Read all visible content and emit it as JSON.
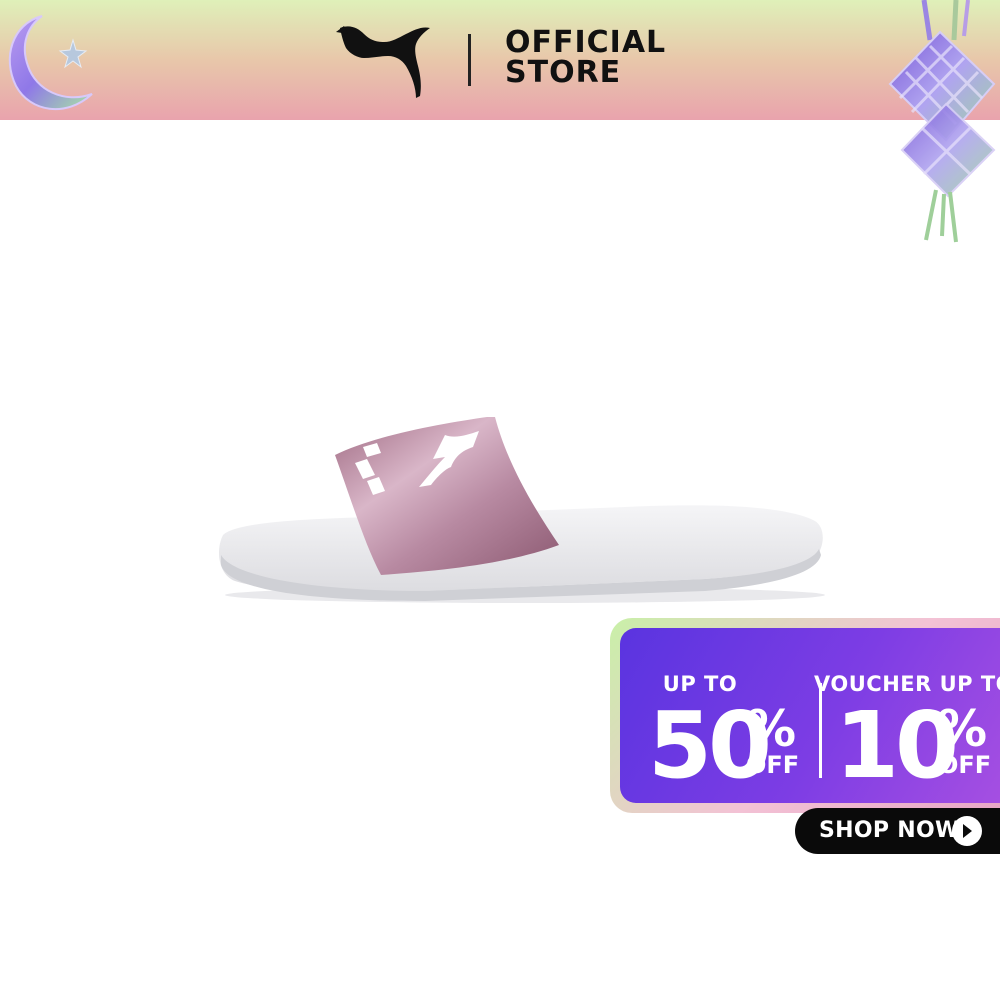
{
  "header": {
    "brand_logo_name": "puma-logo",
    "store_line1": "OFFICIAL",
    "store_line2": "STORE",
    "colors": {
      "top": "#dff0b9",
      "bottom": "#e9a3ad"
    },
    "decorations": [
      "crescent-moon-star-icon",
      "ketupat-icon"
    ]
  },
  "product": {
    "image_name": "puma-slide-sandal-image",
    "colors": {
      "sole": "#f1f1f3",
      "strap": "#b78399",
      "logo": "#ffffff"
    }
  },
  "promo": {
    "left": {
      "caption": "UP TO",
      "value": "50",
      "percent": "%",
      "suffix": "OFF"
    },
    "right": {
      "caption": "VOUCHER UP TO",
      "value": "10",
      "percent": "%",
      "suffix": "OFF"
    },
    "colors": {
      "panel": "#6b38e2",
      "border": "#c9f0a8"
    }
  },
  "cta": {
    "label": "SHOP NOW",
    "icon": "arrow-right-icon"
  }
}
